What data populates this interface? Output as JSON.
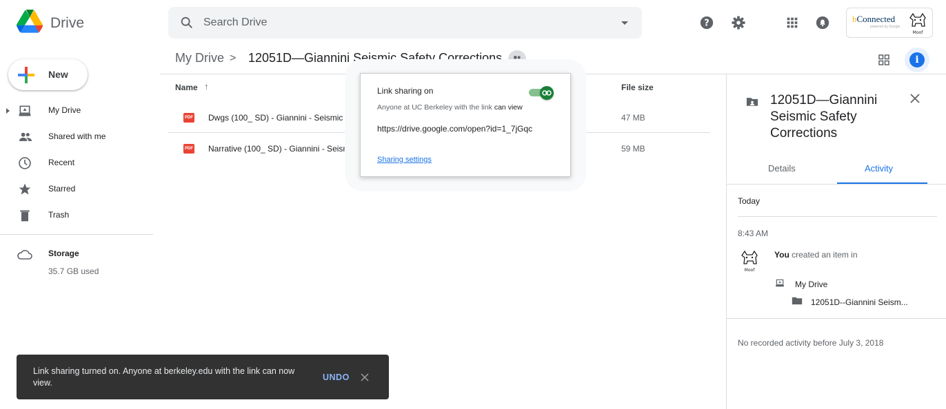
{
  "app": {
    "name": "Drive"
  },
  "search": {
    "placeholder": "Search Drive"
  },
  "account": {
    "org_lead": "b",
    "org_name": "Connected",
    "org_tagline": "powered by Google",
    "avatar_label": "Moof"
  },
  "new_button": {
    "label": "New"
  },
  "sidebar": {
    "items": [
      {
        "label": "My Drive",
        "icon": "drive-icon"
      },
      {
        "label": "Shared with me",
        "icon": "people-icon"
      },
      {
        "label": "Recent",
        "icon": "clock-icon"
      },
      {
        "label": "Starred",
        "icon": "star-icon"
      },
      {
        "label": "Trash",
        "icon": "trash-icon"
      }
    ],
    "storage": {
      "label": "Storage",
      "used": "35.7 GB used"
    }
  },
  "breadcrumb": {
    "root": "My Drive",
    "separator": ">",
    "current": "12051D—Giannini Seismic Safety Corrections"
  },
  "file_list": {
    "columns": {
      "name": "Name",
      "sort_arrow": "↑",
      "truncated": "...",
      "size": "File size"
    },
    "rows": [
      {
        "name": "Dwgs (100_ SD) - Giannini - Seismic (120",
        "size": "47 MB",
        "type_badge": "PDF"
      },
      {
        "name": "Narrative (100_ SD) - Giannini - Seismic",
        "size": "59 MB",
        "type_badge": "PDF"
      }
    ]
  },
  "share_popover": {
    "title": "Link sharing on",
    "subtitle_prefix": "Anyone at UC Berkeley with the link ",
    "subtitle_permission": "can view",
    "url": "https://drive.google.com/open?id=1_7jGqc",
    "settings_link": "Sharing settings",
    "toggle_on": true
  },
  "details_panel": {
    "title": "12051D—Giannini Seismic Safety Corrections",
    "tabs": [
      {
        "label": "Details",
        "active": false
      },
      {
        "label": "Activity",
        "active": true
      }
    ],
    "activity": {
      "day": "Today",
      "time": "8:43 AM",
      "actor": "You",
      "action": " created an item in",
      "avatar_label": "Moof",
      "location_parent": "My Drive",
      "location_folder": "12051D--Giannini Seism...",
      "footer": "No recorded activity before July 3, 2018"
    }
  },
  "snackbar": {
    "message": "Link sharing turned on. Anyone at berkeley.edu with the link can now view.",
    "action": "UNDO"
  },
  "colors": {
    "accent": "#1a73e8",
    "toggle_on": "#188038",
    "pdf": "#ea4335",
    "snackbar": "#323232"
  }
}
